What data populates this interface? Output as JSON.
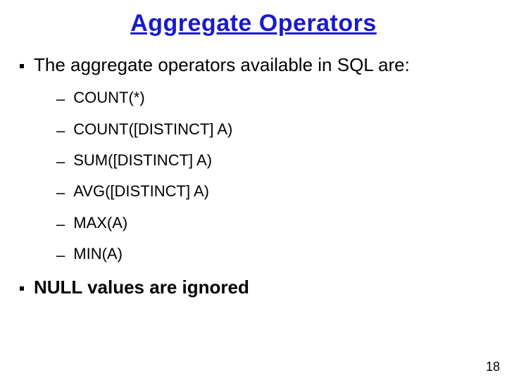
{
  "title": "Aggregate Operators",
  "intro": "The aggregate operators available in SQL are:",
  "operators": [
    "COUNT(*)",
    "COUNT([DISTINCT] A)",
    "SUM([DISTINCT] A)",
    "AVG([DISTINCT] A)",
    "MAX(A)",
    "MIN(A)"
  ],
  "note": "NULL values are ignored",
  "page_number": "18"
}
